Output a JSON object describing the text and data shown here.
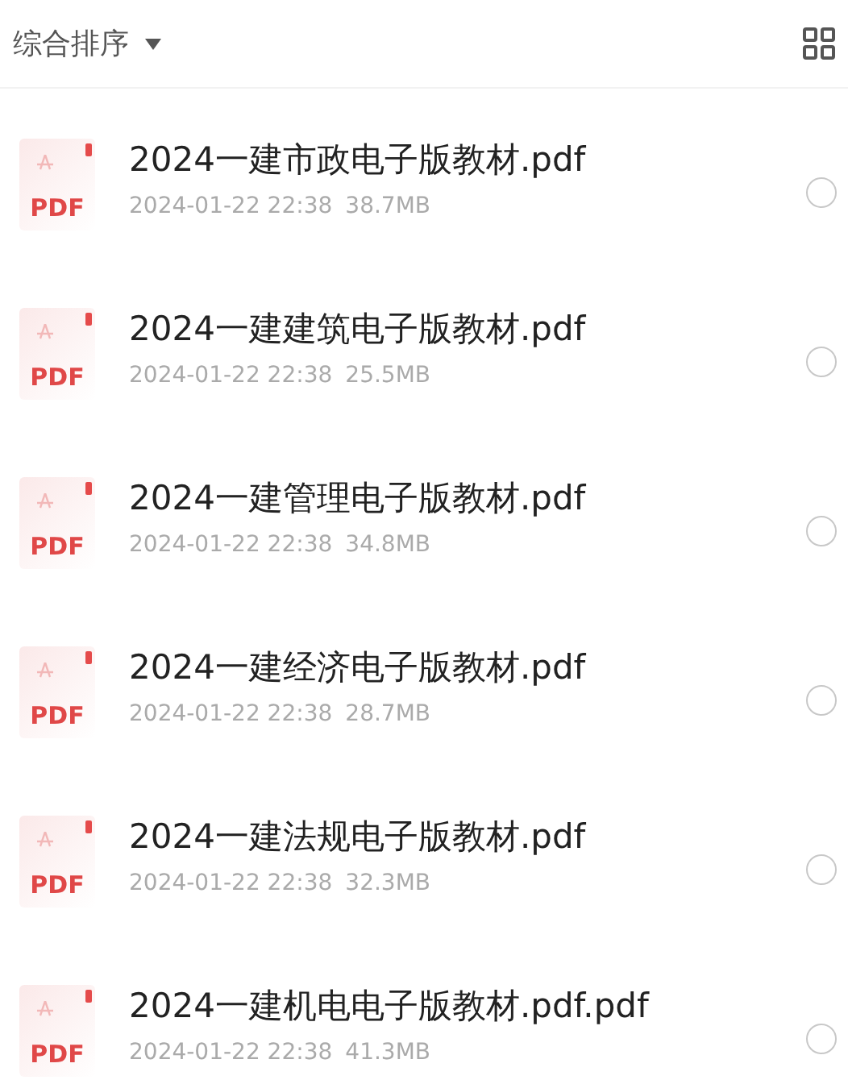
{
  "toolbar": {
    "sort_label": "综合排序"
  },
  "files": [
    {
      "name": "2024一建市政电子版教材.pdf",
      "badge": "PDF",
      "date": "2024-01-22 22:38",
      "size": "38.7MB",
      "selected": false
    },
    {
      "name": "2024一建建筑电子版教材.pdf",
      "badge": "PDF",
      "date": "2024-01-22 22:38",
      "size": "25.5MB",
      "selected": false
    },
    {
      "name": "2024一建管理电子版教材.pdf",
      "badge": "PDF",
      "date": "2024-01-22 22:38",
      "size": "34.8MB",
      "selected": false
    },
    {
      "name": "2024一建经济电子版教材.pdf",
      "badge": "PDF",
      "date": "2024-01-22 22:38",
      "size": "28.7MB",
      "selected": false
    },
    {
      "name": "2024一建法规电子版教材.pdf",
      "badge": "PDF",
      "date": "2024-01-22 22:38",
      "size": "32.3MB",
      "selected": false
    },
    {
      "name": "2024一建机电电子版教材.pdf.pdf",
      "badge": "PDF",
      "date": "2024-01-22 22:38",
      "size": "41.3MB",
      "selected": false
    }
  ]
}
